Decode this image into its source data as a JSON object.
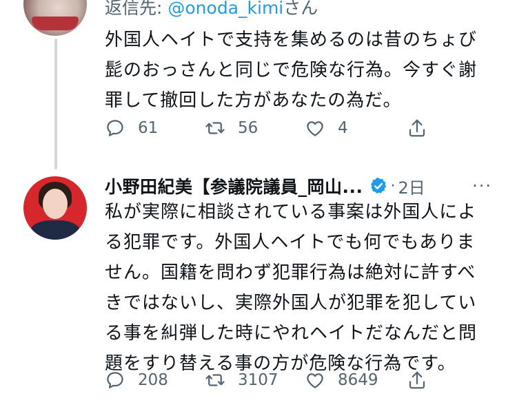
{
  "tweet1": {
    "reply_label": "返信先:",
    "reply_handle": "@onoda_kimi",
    "reply_suffix": "さん",
    "text_lines": [
      "外国人ヘイトで支持を集めるのは昔のちょび",
      "髭のおっさんと同じで危険な行為。今すぐ謝",
      "罪して撤回した方があなたの為だ。"
    ],
    "replies": "61",
    "retweets": "56",
    "likes": "4"
  },
  "tweet2": {
    "display_name": "小野田紀美【参議院議員_岡山...",
    "dot": "·",
    "time": "2日",
    "more": "···",
    "text_lines": [
      "私が実際に相談されている事案は外国人によ",
      "る犯罪です。外国人ヘイトでも何でもありま",
      "せん。国籍を問わず犯罪行為は絶対に許すべ",
      "きではないし、実際外国人が犯罪を犯してい",
      "る事を糾弾した時にやれヘイトだなんだと問",
      "題をすり替える事の方が危険な行為です。"
    ],
    "replies": "208",
    "retweets": "3107",
    "likes": "8649"
  },
  "icons": {
    "reply": "reply-icon",
    "retweet": "retweet-icon",
    "like": "heart-icon",
    "share": "share-icon",
    "verified": "verified-badge-icon"
  },
  "colors": {
    "text": "#0f1419",
    "secondary": "#536471",
    "link": "#1d9bf0",
    "thread_line": "#cfd9de",
    "avatar_bg": "#d8262d"
  }
}
